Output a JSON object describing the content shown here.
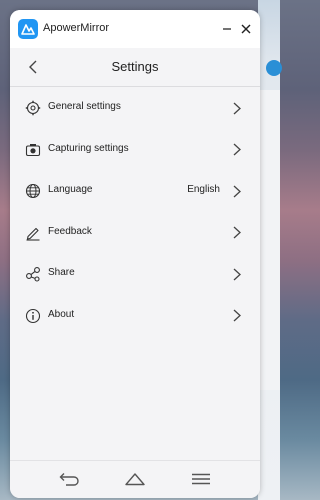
{
  "app": {
    "title": "ApowerMirror",
    "accent_color": "#2196f3"
  },
  "header": {
    "title": "Settings"
  },
  "menu": {
    "items": [
      {
        "label": "General settings",
        "icon": "gear-icon"
      },
      {
        "label": "Capturing settings",
        "icon": "camera-icon"
      },
      {
        "label": "Language",
        "icon": "globe-icon",
        "value": "English"
      },
      {
        "label": "Feedback",
        "icon": "pencil-icon"
      },
      {
        "label": "Share",
        "icon": "share-icon"
      },
      {
        "label": "About",
        "icon": "info-icon"
      }
    ]
  },
  "bottom_nav": {
    "icons": [
      "back-arrow-icon",
      "home-icon",
      "menu-icon"
    ]
  }
}
